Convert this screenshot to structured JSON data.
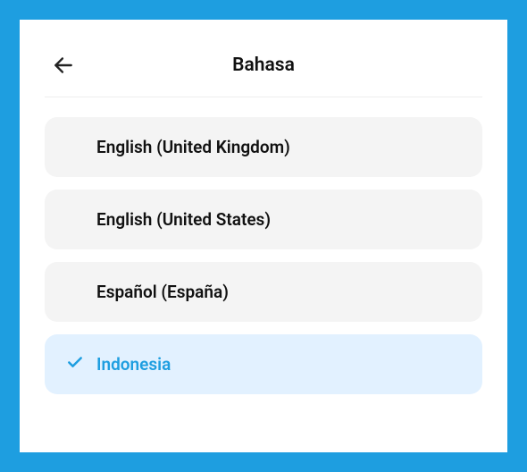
{
  "header": {
    "title": "Bahasa"
  },
  "languages": [
    {
      "label": "English (United Kingdom)",
      "selected": false
    },
    {
      "label": "English (United States)",
      "selected": false
    },
    {
      "label": "Español (España)",
      "selected": false
    },
    {
      "label": "Indonesia",
      "selected": true
    }
  ]
}
